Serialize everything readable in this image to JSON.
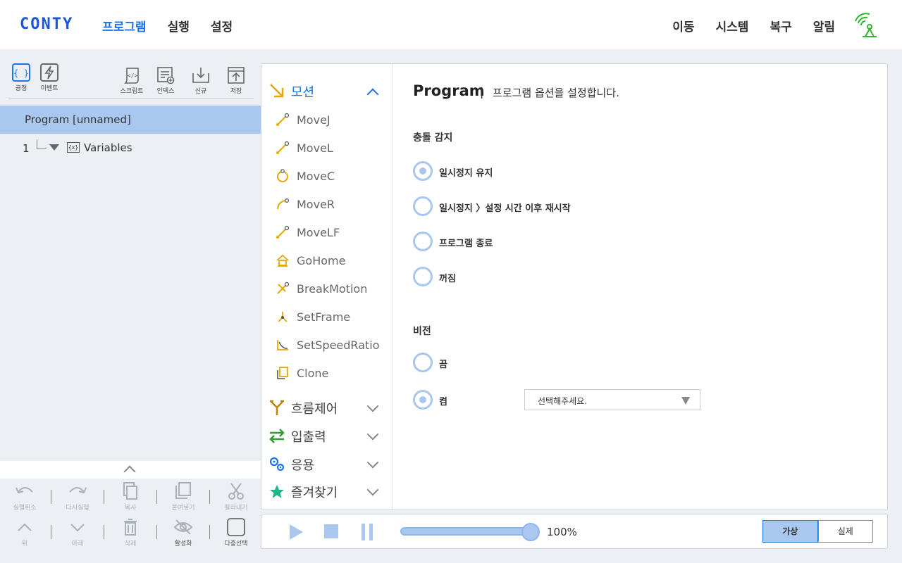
{
  "app": {
    "logo": "CONTY"
  },
  "nav": {
    "main": [
      "프로그램",
      "실행",
      "설정"
    ],
    "right": [
      "이동",
      "시스템",
      "복구",
      "알림"
    ]
  },
  "left_toolbar": {
    "tools": [
      {
        "label": "공정",
        "icon": "braces-icon"
      },
      {
        "label": "이벤트",
        "icon": "lightning-icon"
      },
      {
        "label": "스크립트",
        "icon": "script-icon"
      },
      {
        "label": "인덱스",
        "icon": "index-icon"
      },
      {
        "label": "신규",
        "icon": "new-icon"
      },
      {
        "label": "저장",
        "icon": "save-icon"
      }
    ]
  },
  "tree": {
    "root": "Program [unnamed]",
    "items": [
      {
        "num": "1",
        "label": "Variables",
        "icon_text": "{x}"
      }
    ]
  },
  "edit_tools": {
    "row1": [
      "실행취소",
      "다시실행",
      "복사",
      "붙여넣기",
      "잘라내기"
    ],
    "row2": [
      "위",
      "아래",
      "삭제",
      "활성화",
      "다중선택"
    ]
  },
  "commands": {
    "categories": [
      {
        "label": "모션",
        "color": "#1a73e8",
        "expanded": true
      },
      {
        "label": "흐름제어",
        "color": "#b8860b",
        "expanded": false
      },
      {
        "label": "입출력",
        "color": "#2e9e2e",
        "expanded": false
      },
      {
        "label": "응용",
        "color": "#1a73e8",
        "expanded": false
      },
      {
        "label": "즐겨찾기",
        "color": "#1fb58a",
        "expanded": false
      }
    ],
    "motion_items": [
      "MoveJ",
      "MoveL",
      "MoveC",
      "MoveR",
      "MoveLF",
      "GoHome",
      "BreakMotion",
      "SetFrame",
      "SetSpeedRatio",
      "Clone"
    ]
  },
  "options": {
    "title": "Program",
    "separator": "|",
    "description": "프로그램 옵션을 설정합니다.",
    "collision_label": "충돌 감지",
    "collision_options": [
      "일시정지 유지",
      "일시정지 〉설정 시간 이후 재시작",
      "프로그램 종료",
      "꺼짐"
    ],
    "collision_selected": 0,
    "vision_label": "비전",
    "vision_options": [
      "끔",
      "켬"
    ],
    "vision_selected": 1,
    "vision_select_placeholder": "선택해주세요."
  },
  "runbar": {
    "speed_text": "100%",
    "speed_fraction": 1.0,
    "modes": [
      "가상",
      "실제"
    ],
    "active_mode": 0
  },
  "colors": {
    "accent": "#1a73e8",
    "selected_bg": "#a9c7ef",
    "signal_icon": "#2eb82e"
  }
}
